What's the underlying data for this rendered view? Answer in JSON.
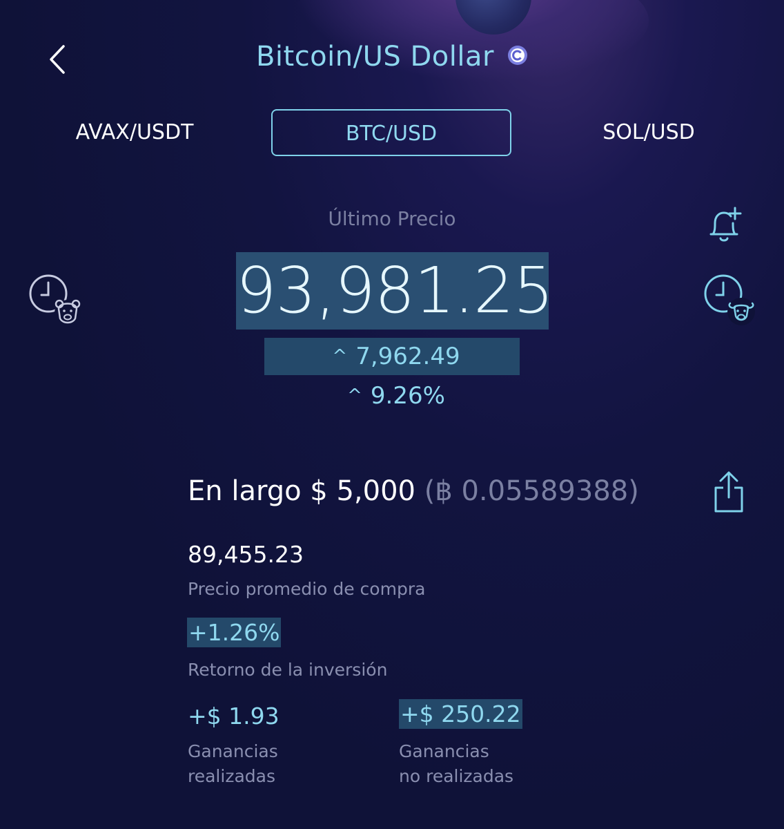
{
  "header": {
    "title": "Bitcoin/US Dollar",
    "back_icon": "chevron-left-icon",
    "badge_icon": "coin-badge-icon"
  },
  "tabs": [
    {
      "label": "AVAX/USDT"
    },
    {
      "label": "BTC/USD",
      "active": true
    },
    {
      "label": "SOL/USD"
    }
  ],
  "price": {
    "label": "Último Precio",
    "value": "93,981.25",
    "change_abs": "7,962.49",
    "change_pct": "9.26%"
  },
  "icons": {
    "bear": "clock-bear-icon",
    "bull": "clock-bull-icon",
    "alert": "bell-plus-icon",
    "share": "share-icon"
  },
  "position": {
    "prefix": "En largo $ 5,000",
    "btc": "(฿ 0.05589388)",
    "avg_price": "89,455.23",
    "avg_price_label": "Precio promedio de compra",
    "roi": "+1.26%",
    "roi_label": "Retorno de la inversión",
    "realized": "+$ 1.93",
    "realized_label_1": "Ganancias",
    "realized_label_2": "realizadas",
    "unrealized": "+$ 250.22",
    "unrealized_label_1": "Ganancias",
    "unrealized_label_2": "no realizadas"
  },
  "colors": {
    "background": "#0f1238",
    "accent": "#8fd8ef",
    "highlight": "#24496a",
    "muted": "#8a8fb0"
  }
}
